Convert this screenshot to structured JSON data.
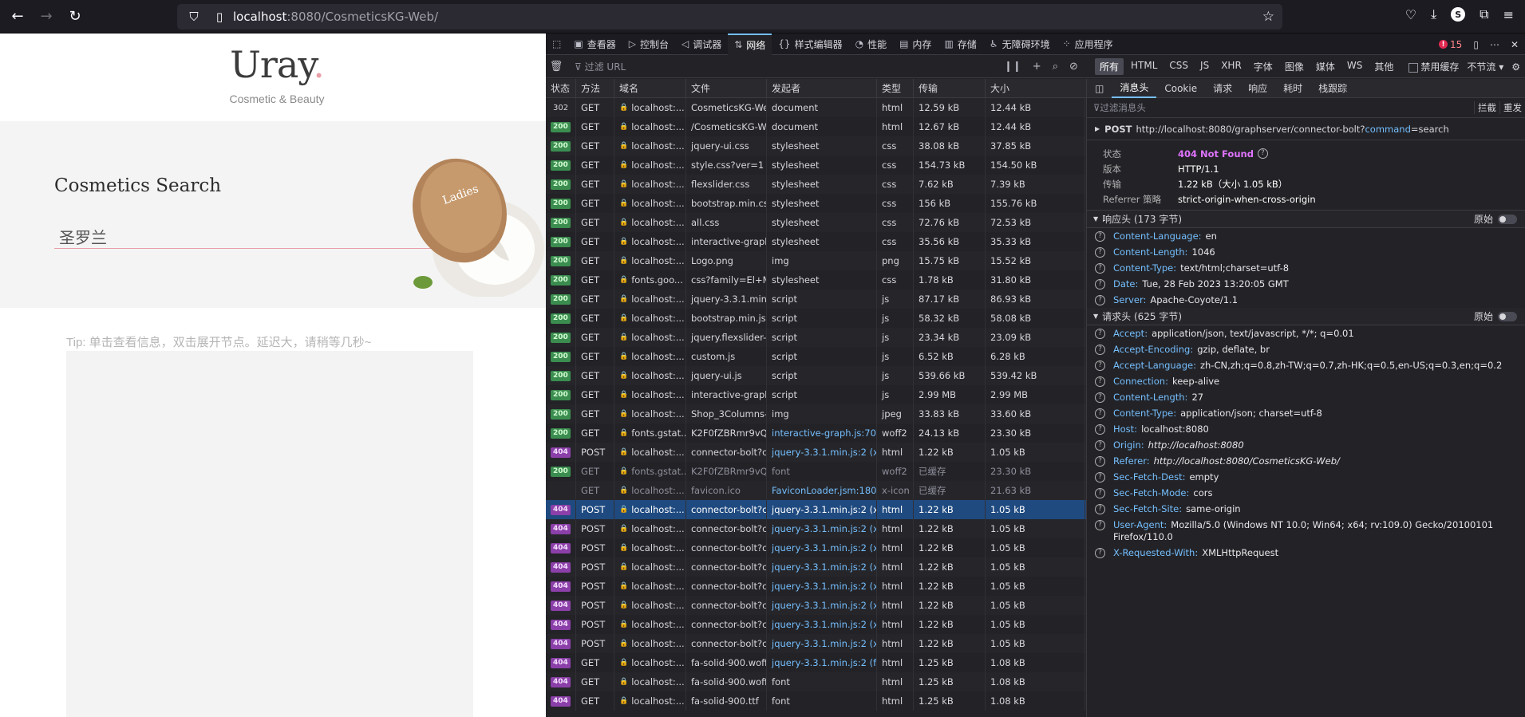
{
  "browser": {
    "url_host": "localhost",
    "url_rest": ":8080/CosmeticsKG-Web/",
    "profile_initial": "S"
  },
  "page": {
    "logo_text": "Uray",
    "logo_dot": ".",
    "tagline": "Cosmetic & Beauty",
    "hero_title": "Cosmetics Search",
    "search_value": "圣罗兰",
    "product_label": "Ladies",
    "tip": "Tip: 单击查看信息，双击展开节点。延迟大，请稍等几秒~"
  },
  "devtools": {
    "tabs": [
      {
        "label": "查看器",
        "icon": "inspector-icon"
      },
      {
        "label": "控制台",
        "icon": "console-icon"
      },
      {
        "label": "调试器",
        "icon": "debugger-icon"
      },
      {
        "label": "网络",
        "icon": "network-icon",
        "active": true
      },
      {
        "label": "样式编辑器",
        "icon": "style-editor-icon"
      },
      {
        "label": "性能",
        "icon": "performance-icon"
      },
      {
        "label": "内存",
        "icon": "memory-icon"
      },
      {
        "label": "存储",
        "icon": "storage-icon"
      },
      {
        "label": "无障碍环境",
        "icon": "accessibility-icon"
      },
      {
        "label": "应用程序",
        "icon": "application-icon"
      }
    ],
    "error_count": "15",
    "filter_placeholder": "过滤 URL",
    "type_filters": [
      "所有",
      "HTML",
      "CSS",
      "JS",
      "XHR",
      "字体",
      "图像",
      "媒体",
      "WS",
      "其他"
    ],
    "disable_cache": "禁用缓存",
    "throttle": "不节流 ▾",
    "columns": [
      "状态",
      "方法",
      "域名",
      "文件",
      "发起者",
      "类型",
      "传输",
      "大小"
    ],
    "requests": [
      {
        "status": "302",
        "method": "GET",
        "domain": "localhost:...",
        "file": "CosmeticsKG-Web",
        "initiator": "document",
        "type": "html",
        "transfer": "12.59 kB",
        "size": "12.44 kB"
      },
      {
        "status": "200",
        "method": "GET",
        "domain": "localhost:...",
        "file": "/CosmeticsKG-We",
        "initiator": "document",
        "type": "html",
        "transfer": "12.67 kB",
        "size": "12.44 kB"
      },
      {
        "status": "200",
        "method": "GET",
        "domain": "localhost:...",
        "file": "jquery-ui.css",
        "initiator": "stylesheet",
        "type": "css",
        "transfer": "38.08 kB",
        "size": "37.85 kB"
      },
      {
        "status": "200",
        "method": "GET",
        "domain": "localhost:...",
        "file": "style.css?ver=1",
        "initiator": "stylesheet",
        "type": "css",
        "transfer": "154.73 kB",
        "size": "154.50 kB"
      },
      {
        "status": "200",
        "method": "GET",
        "domain": "localhost:...",
        "file": "flexslider.css",
        "initiator": "stylesheet",
        "type": "css",
        "transfer": "7.62 kB",
        "size": "7.39 kB"
      },
      {
        "status": "200",
        "method": "GET",
        "domain": "localhost:...",
        "file": "bootstrap.min.css",
        "initiator": "stylesheet",
        "type": "css",
        "transfer": "156 kB",
        "size": "155.76 kB"
      },
      {
        "status": "200",
        "method": "GET",
        "domain": "localhost:...",
        "file": "all.css",
        "initiator": "stylesheet",
        "type": "css",
        "transfer": "72.76 kB",
        "size": "72.53 kB"
      },
      {
        "status": "200",
        "method": "GET",
        "domain": "localhost:...",
        "file": "interactive-graph.",
        "initiator": "stylesheet",
        "type": "css",
        "transfer": "35.56 kB",
        "size": "35.33 kB"
      },
      {
        "status": "200",
        "method": "GET",
        "domain": "localhost:...",
        "file": "Logo.png",
        "initiator": "img",
        "type": "png",
        "transfer": "15.75 kB",
        "size": "15.52 kB"
      },
      {
        "status": "200",
        "method": "GET",
        "domain": "fonts.goo...",
        "file": "css?family=El+Me",
        "initiator": "stylesheet",
        "type": "css",
        "transfer": "1.78 kB",
        "size": "31.80 kB"
      },
      {
        "status": "200",
        "method": "GET",
        "domain": "localhost:...",
        "file": "jquery-3.3.1.min.js",
        "initiator": "script",
        "type": "js",
        "transfer": "87.17 kB",
        "size": "86.93 kB"
      },
      {
        "status": "200",
        "method": "GET",
        "domain": "localhost:...",
        "file": "bootstrap.min.js",
        "initiator": "script",
        "type": "js",
        "transfer": "58.32 kB",
        "size": "58.08 kB"
      },
      {
        "status": "200",
        "method": "GET",
        "domain": "localhost:...",
        "file": "jquery.flexslider-m",
        "initiator": "script",
        "type": "js",
        "transfer": "23.34 kB",
        "size": "23.09 kB"
      },
      {
        "status": "200",
        "method": "GET",
        "domain": "localhost:...",
        "file": "custom.js",
        "initiator": "script",
        "type": "js",
        "transfer": "6.52 kB",
        "size": "6.28 kB"
      },
      {
        "status": "200",
        "method": "GET",
        "domain": "localhost:...",
        "file": "jquery-ui.js",
        "initiator": "script",
        "type": "js",
        "transfer": "539.66 kB",
        "size": "539.42 kB"
      },
      {
        "status": "200",
        "method": "GET",
        "domain": "localhost:...",
        "file": "interactive-graph.j",
        "initiator": "script",
        "type": "js",
        "transfer": "2.99 MB",
        "size": "2.99 MB"
      },
      {
        "status": "200",
        "method": "GET",
        "domain": "localhost:...",
        "file": "Shop_3Columns-t",
        "initiator": "img",
        "type": "jpeg",
        "transfer": "33.83 kB",
        "size": "33.60 kB"
      },
      {
        "status": "200",
        "method": "GET",
        "domain": "fonts.gstat...",
        "file": "K2F0fZBRmr9vQ1p",
        "initiator": "interactive-graph.js:70...",
        "initiator_link": true,
        "type": "woff2",
        "transfer": "24.13 kB",
        "size": "23.30 kB"
      },
      {
        "status": "404",
        "method": "POST",
        "domain": "localhost:...",
        "file": "connector-bolt?co",
        "initiator": "jquery-3.3.1.min.js:2 (x...",
        "initiator_link": true,
        "type": "html",
        "transfer": "1.22 kB",
        "size": "1.05 kB"
      },
      {
        "status": "200",
        "method": "GET",
        "domain": "fonts.gstat...",
        "file": "K2F0fZBRmr9vQ1p",
        "initiator": "font",
        "type": "woff2",
        "transfer": "已缓存",
        "size": "23.30 kB",
        "cached": true
      },
      {
        "status": "",
        "method": "GET",
        "domain": "localhost:...",
        "file": "favicon.ico",
        "initiator": "FaviconLoader.jsm:180...",
        "initiator_link": true,
        "type": "x-icon",
        "transfer": "已缓存",
        "size": "21.63 kB",
        "cached": true
      },
      {
        "status": "404",
        "method": "POST",
        "domain": "localhost:...",
        "file": "connector-bolt?co",
        "initiator": "jquery-3.3.1.min.js:2 (x...",
        "type": "html",
        "transfer": "1.22 kB",
        "size": "1.05 kB",
        "selected": true
      },
      {
        "status": "404",
        "method": "POST",
        "domain": "localhost:...",
        "file": "connector-bolt?co",
        "initiator": "jquery-3.3.1.min.js:2 (x...",
        "initiator_link": true,
        "type": "html",
        "transfer": "1.22 kB",
        "size": "1.05 kB"
      },
      {
        "status": "404",
        "method": "POST",
        "domain": "localhost:...",
        "file": "connector-bolt?co",
        "initiator": "jquery-3.3.1.min.js:2 (x...",
        "initiator_link": true,
        "type": "html",
        "transfer": "1.22 kB",
        "size": "1.05 kB"
      },
      {
        "status": "404",
        "method": "POST",
        "domain": "localhost:...",
        "file": "connector-bolt?co",
        "initiator": "jquery-3.3.1.min.js:2 (x...",
        "initiator_link": true,
        "type": "html",
        "transfer": "1.22 kB",
        "size": "1.05 kB"
      },
      {
        "status": "404",
        "method": "POST",
        "domain": "localhost:...",
        "file": "connector-bolt?co",
        "initiator": "jquery-3.3.1.min.js:2 (x...",
        "initiator_link": true,
        "type": "html",
        "transfer": "1.22 kB",
        "size": "1.05 kB"
      },
      {
        "status": "404",
        "method": "POST",
        "domain": "localhost:...",
        "file": "connector-bolt?co",
        "initiator": "jquery-3.3.1.min.js:2 (x...",
        "initiator_link": true,
        "type": "html",
        "transfer": "1.22 kB",
        "size": "1.05 kB"
      },
      {
        "status": "404",
        "method": "POST",
        "domain": "localhost:...",
        "file": "connector-bolt?co",
        "initiator": "jquery-3.3.1.min.js:2 (x...",
        "initiator_link": true,
        "type": "html",
        "transfer": "1.22 kB",
        "size": "1.05 kB"
      },
      {
        "status": "404",
        "method": "POST",
        "domain": "localhost:...",
        "file": "connector-bolt?co",
        "initiator": "jquery-3.3.1.min.js:2 (x...",
        "initiator_link": true,
        "type": "html",
        "transfer": "1.22 kB",
        "size": "1.05 kB"
      },
      {
        "status": "404",
        "method": "GET",
        "domain": "localhost:...",
        "file": "fa-solid-900.woff2",
        "initiator": "jquery-3.3.1.min.js:2 (f...",
        "initiator_link": true,
        "type": "html",
        "transfer": "1.25 kB",
        "size": "1.08 kB"
      },
      {
        "status": "404",
        "method": "GET",
        "domain": "localhost:...",
        "file": "fa-solid-900.woff",
        "initiator": "font",
        "type": "html",
        "transfer": "1.25 kB",
        "size": "1.08 kB"
      },
      {
        "status": "404",
        "method": "GET",
        "domain": "localhost:...",
        "file": "fa-solid-900.ttf",
        "initiator": "font",
        "type": "html",
        "transfer": "1.25 kB",
        "size": "1.08 kB"
      }
    ],
    "detail": {
      "tabs": [
        "消息头",
        "Cookie",
        "请求",
        "响应",
        "耗时",
        "栈跟踪"
      ],
      "filter_placeholder": "过滤消息头",
      "block_label": "拦截",
      "resend_label": "重发",
      "post_method": "POST",
      "post_url": "http://localhost:8080/graphserver/connector-bolt?",
      "post_query_key": "command",
      "post_query_rest": "=search",
      "summary": [
        {
          "key": "状态",
          "value": "404 Not Found",
          "status": true
        },
        {
          "key": "版本",
          "value": "HTTP/1.1"
        },
        {
          "key": "传输",
          "value": "1.22 kB（大小 1.05 kB）"
        },
        {
          "key": "Referrer 策略",
          "value": "strict-origin-when-cross-origin"
        }
      ],
      "raw_label": "原始",
      "response_title": "响应头 (173 字节)",
      "response_headers": [
        {
          "k": "Content-Language:",
          "v": "en"
        },
        {
          "k": "Content-Length:",
          "v": "1046"
        },
        {
          "k": "Content-Type:",
          "v": "text/html;charset=utf-8"
        },
        {
          "k": "Date:",
          "v": "Tue, 28 Feb 2023 13:20:05 GMT"
        },
        {
          "k": "Server:",
          "v": "Apache-Coyote/1.1"
        }
      ],
      "request_title": "请求头 (625 字节)",
      "request_headers": [
        {
          "k": "Accept:",
          "v": "application/json, text/javascript, */*; q=0.01"
        },
        {
          "k": "Accept-Encoding:",
          "v": "gzip, deflate, br"
        },
        {
          "k": "Accept-Language:",
          "v": "zh-CN,zh;q=0.8,zh-TW;q=0.7,zh-HK;q=0.5,en-US;q=0.3,en;q=0.2"
        },
        {
          "k": "Connection:",
          "v": "keep-alive"
        },
        {
          "k": "Content-Length:",
          "v": "27"
        },
        {
          "k": "Content-Type:",
          "v": "application/json; charset=utf-8"
        },
        {
          "k": "Host:",
          "v": "localhost:8080"
        },
        {
          "k": "Origin:",
          "v": "http://localhost:8080",
          "italic": true
        },
        {
          "k": "Referer:",
          "v": "http://localhost:8080/CosmeticsKG-Web/",
          "italic": true
        },
        {
          "k": "Sec-Fetch-Dest:",
          "v": "empty"
        },
        {
          "k": "Sec-Fetch-Mode:",
          "v": "cors"
        },
        {
          "k": "Sec-Fetch-Site:",
          "v": "same-origin"
        },
        {
          "k": "User-Agent:",
          "v": "Mozilla/5.0 (Windows NT 10.0; Win64; x64; rv:109.0) Gecko/20100101 Firefox/110.0"
        },
        {
          "k": "X-Requested-With:",
          "v": "XMLHttpRequest"
        }
      ]
    }
  }
}
